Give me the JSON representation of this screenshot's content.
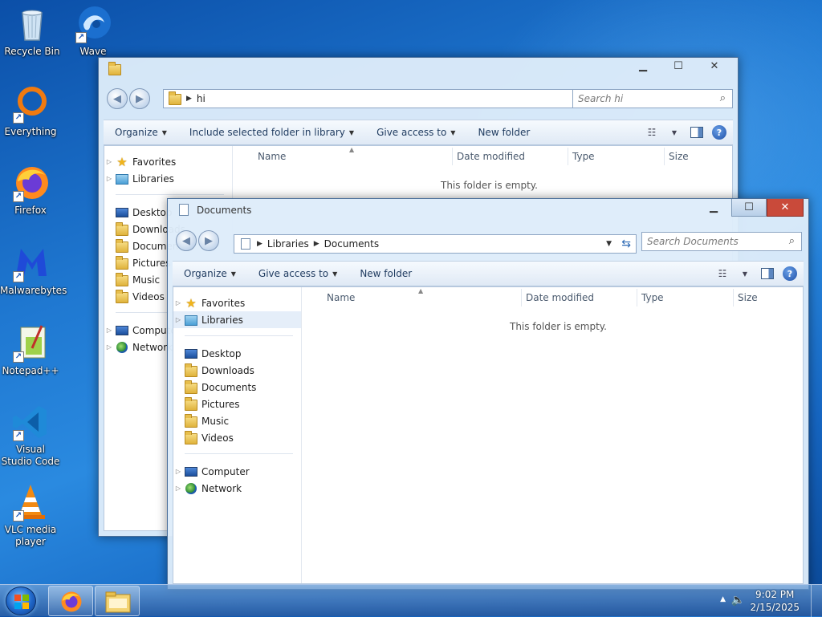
{
  "desktop": {
    "icons": [
      {
        "label": "Recycle Bin",
        "icon": "recycle-bin-icon"
      },
      {
        "label": "Wave",
        "icon": "wave-icon"
      },
      {
        "label": "Everything",
        "icon": "everything-icon"
      },
      {
        "label": "Firefox",
        "icon": "firefox-icon"
      },
      {
        "label": "Malwarebytes",
        "icon": "malwarebytes-icon"
      },
      {
        "label": "Notepad++",
        "icon": "notepadpp-icon"
      },
      {
        "label": "Visual Studio Code",
        "icon": "vscode-icon"
      },
      {
        "label": "VLC media player",
        "icon": "vlc-icon"
      }
    ]
  },
  "window_back": {
    "address": {
      "segments": [
        "hi"
      ]
    },
    "search_placeholder": "Search hi",
    "toolbar": {
      "organize": "Organize",
      "include": "Include selected folder in library",
      "share": "Give access to",
      "new_folder": "New folder"
    },
    "nav": {
      "favorites": "Favorites",
      "libraries": "Libraries",
      "desktop": "Desktop",
      "downloads": "Downloads",
      "documents": "Documents",
      "pictures": "Pictures",
      "music": "Music",
      "videos": "Videos",
      "computer": "Computer",
      "network": "Network"
    },
    "columns": {
      "name": "Name",
      "date": "Date modified",
      "type": "Type",
      "size": "Size"
    },
    "empty_text": "This folder is empty."
  },
  "window_front": {
    "title": "Documents",
    "address": {
      "segments": [
        "Libraries",
        "Documents"
      ]
    },
    "search_placeholder": "Search Documents",
    "toolbar": {
      "organize": "Organize",
      "share": "Give access to",
      "new_folder": "New folder"
    },
    "nav": {
      "favorites": "Favorites",
      "libraries": "Libraries",
      "desktop": "Desktop",
      "downloads": "Downloads",
      "documents": "Documents",
      "pictures": "Pictures",
      "music": "Music",
      "videos": "Videos",
      "computer": "Computer",
      "network": "Network"
    },
    "columns": {
      "name": "Name",
      "date": "Date modified",
      "type": "Type",
      "size": "Size"
    },
    "empty_text": "This folder is empty."
  },
  "taskbar": {
    "apps": [
      "firefox-icon",
      "file-explorer-icon"
    ],
    "time": "9:02 PM",
    "date": "2/15/2025"
  },
  "colors": {
    "close_button": "#c94a3a",
    "taskbar": "#285aa0",
    "desktop_blue": "#1f78d1"
  }
}
